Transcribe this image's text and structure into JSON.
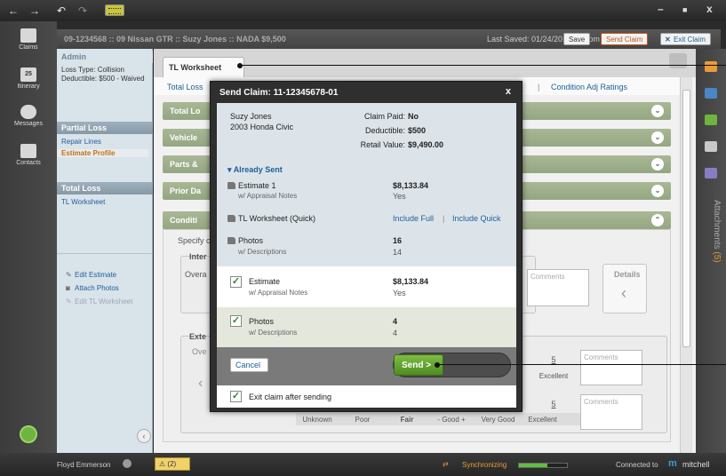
{
  "titlebar": {
    "nav_back": "←",
    "nav_forward": "→",
    "undo": "↶",
    "redo": "↷",
    "minimize": "–",
    "maximize": "■",
    "close": "x"
  },
  "leftnav": {
    "items": [
      {
        "label": "Claims",
        "icon": "claims-icon"
      },
      {
        "label": "Itinerary",
        "icon": "calendar-icon",
        "badge": "25"
      },
      {
        "label": "Messages",
        "icon": "messages-icon"
      },
      {
        "label": "Contacts",
        "icon": "contacts-icon"
      }
    ]
  },
  "header": {
    "claim_id": "09-1234568 :: 09 Nissan GTR :: Suzy Jones :: NADA $9,500",
    "last_saved": "Last Saved: 01/24/2011 1:25pm",
    "save_label": "Save",
    "send_claim_label": "Send Claim",
    "exit_claim_label": "Exit Claim"
  },
  "leftpanel": {
    "admin_header": "Admin",
    "loss_type": "Loss Type: Collision",
    "deductible": "Deductible: $500 - Waived",
    "partial_loss_header": "Partial Loss",
    "repair_lines": "Repair Lines",
    "estimate_profile": "Estimate Profile",
    "total_loss_header": "Total Loss",
    "tl_worksheet": "TL Worksheet",
    "edit_estimate": "Edit Estimate",
    "attach_photos": "Attach Photos",
    "edit_tl_worksheet": "Edit TL Worksheet"
  },
  "main": {
    "tab_label": "TL Worksheet",
    "subtab_left": "Total Loss",
    "subtab_right": "Condition Adj Ratings",
    "sections": [
      "Total Lo",
      "Vehicle",
      "Parts &",
      "Prior Da",
      "Conditi"
    ],
    "specify_text": "Specify c",
    "interior_label": "Inter",
    "overall_label": "Overa",
    "exterior_label": "Exte",
    "exterior_overall": "Ove",
    "details_label": "Details",
    "comments_placeholder": "Comments",
    "rating_value": "5",
    "rating_excellent": "Excellent",
    "rating_scale": [
      "Unknown",
      "Poor",
      "Fair",
      "- Good +",
      "Very Good",
      "Excellent"
    ]
  },
  "attachments": {
    "label": "Attachments",
    "count": "(5)"
  },
  "modal": {
    "title": "Send Claim: 11-12345678-01",
    "close": "x",
    "customer_name": "Suzy Jones",
    "vehicle": "2003 Honda Civic",
    "claim_paid_label": "Claim Paid:",
    "claim_paid_value": "No",
    "deductible_label": "Deductible:",
    "deductible_value": "$500",
    "retail_value_label": "Retail Value:",
    "retail_value_value": "$9,490.00",
    "already_sent": "Already Sent",
    "sent_items": [
      {
        "name": "Estimate 1",
        "sub": "w/ Appraisal Notes",
        "value": "$8,133.84",
        "value2": "Yes"
      },
      {
        "name": "TL Worksheet (Quick)",
        "include_full": "Include Full",
        "separator": "|",
        "include_quick": "Include Quick"
      },
      {
        "name": "Photos",
        "sub": "w/ Descriptions",
        "value": "16",
        "value2": "14"
      }
    ],
    "to_send": [
      {
        "name": "Estimate",
        "sub": "w/ Appraisal Notes",
        "value": "$8,133.84",
        "value2": "Yes"
      },
      {
        "name": "Photos",
        "sub": "w/ Descriptions",
        "value": "4",
        "value2": "4"
      }
    ],
    "cancel_label": "Cancel",
    "send_label": "Send >",
    "exit_after_sending": "Exit claim after sending"
  },
  "statusbar": {
    "user": "Floyd Emmerson",
    "alerts": "(2)",
    "sync_text": "Synchronizing",
    "sync_progress": 0.6,
    "connected_to": "Connected to",
    "brand": "mitchell"
  },
  "colors": {
    "accent_orange": "#e89b3b",
    "link_blue": "#1c5f9a",
    "send_green": "#5ea52e",
    "section_green": "#a0b08c"
  }
}
